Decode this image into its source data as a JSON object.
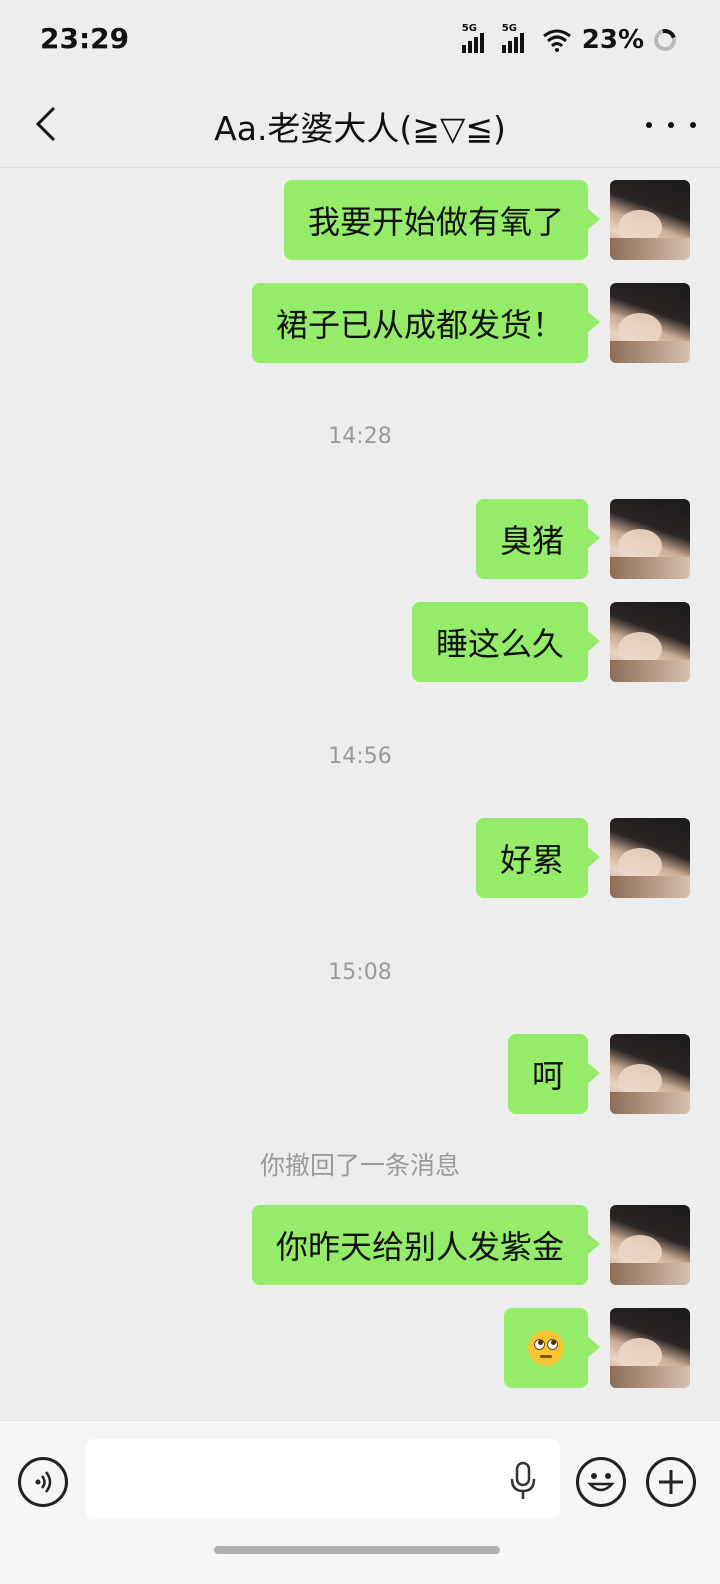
{
  "status_bar": {
    "time": "23:29",
    "signal_1_label": "5G",
    "signal_2_label": "5G",
    "battery": "23%"
  },
  "header": {
    "title": "Aa.老婆大人(≧▽≦)"
  },
  "messages": [
    {
      "type": "sent",
      "text": "我要开始做有氧了"
    },
    {
      "type": "sent",
      "text": "裙子已从成都发货！"
    },
    {
      "type": "time",
      "text": "14:28"
    },
    {
      "type": "sent",
      "text": "臭猪"
    },
    {
      "type": "sent",
      "text": "睡这么久"
    },
    {
      "type": "time",
      "text": "14:56"
    },
    {
      "type": "sent",
      "text": "好累"
    },
    {
      "type": "time",
      "text": "15:08"
    },
    {
      "type": "sent",
      "text": "呵"
    },
    {
      "type": "system",
      "text": "你撤回了一条消息"
    },
    {
      "type": "sent",
      "text": "你昨天给别人发紫金"
    },
    {
      "type": "sent-emoji",
      "emoji": "eye-roll-emoji"
    }
  ],
  "input_bar": {
    "value": "",
    "placeholder": ""
  },
  "colors": {
    "background": "#ededed",
    "sent_bubble": "#95ec69",
    "timestamp_text": "#9a9a9a"
  },
  "icons": [
    "back-arrow-icon",
    "more-dots-icon",
    "voice-icon",
    "microphone-icon",
    "emoji-icon",
    "plus-icon"
  ]
}
